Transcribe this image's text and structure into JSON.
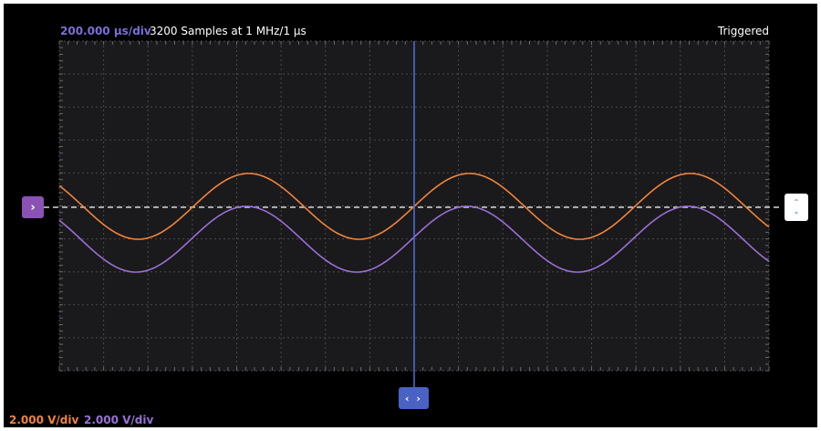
{
  "header": {
    "timebase": "200.000 µs/div",
    "samples": "3200 Samples at 1 MHz/1 µs",
    "trigger_status": "Triggered"
  },
  "footer": {
    "channel1_scale": "2.000 V/div",
    "channel2_scale": "2.000 V/div"
  },
  "colors": {
    "background": "#000000",
    "plot_background": "#1a191b",
    "channel1": "#f0843c",
    "channel2": "#9a6fd8",
    "time_cursor": "#4a72e0",
    "trigger_line": "#d0d0d0"
  },
  "icons": {
    "channel_offset": "chevron-right-icon",
    "trigger_level": "chevron-up-down-icon",
    "time_position": "chevron-left-right-icon"
  },
  "controls": {
    "channel_offset_glyph": "›",
    "trigger_up_glyph": "⌃",
    "trigger_down_glyph": "⌄",
    "time_position_glyph": "‹ ›"
  }
}
